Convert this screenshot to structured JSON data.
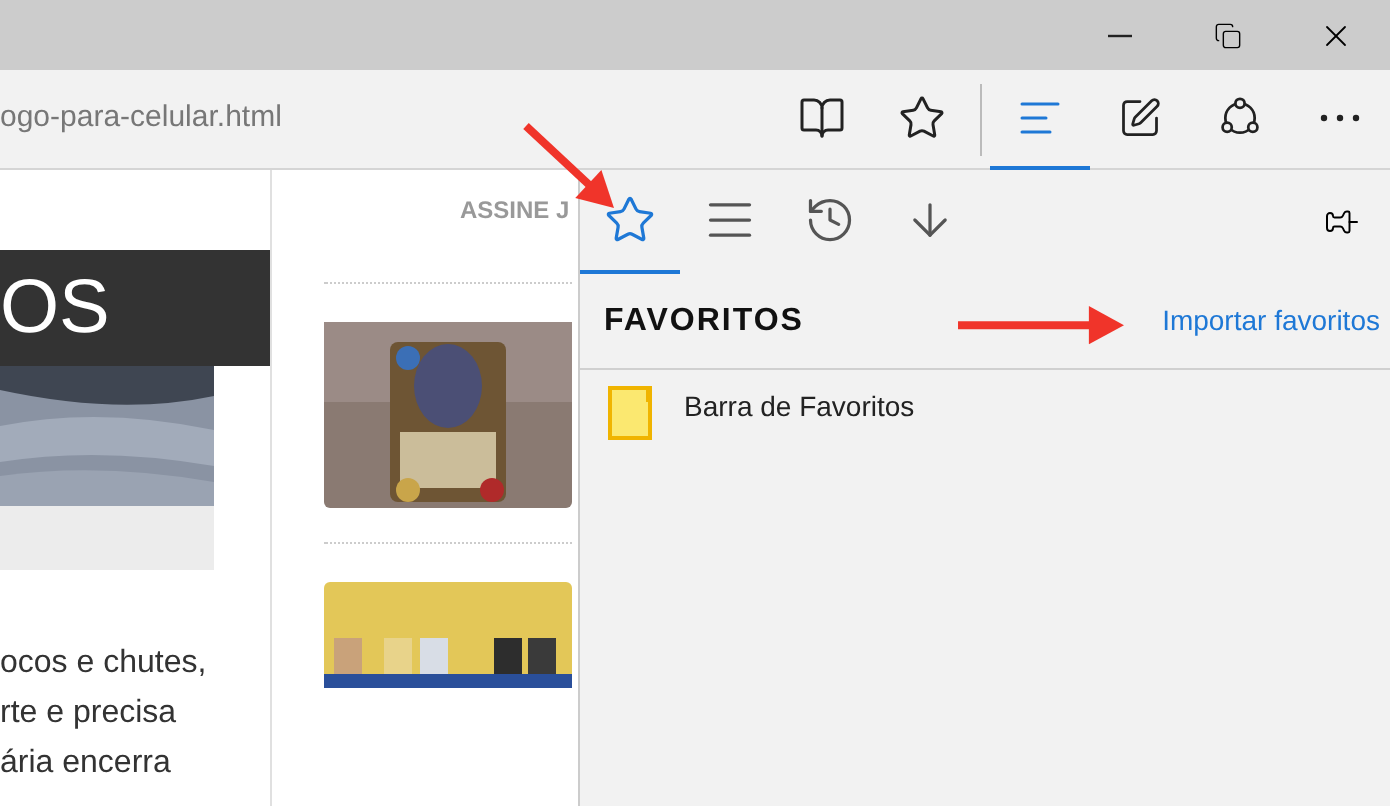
{
  "address_bar": {
    "url": "ogo-para-celular.html"
  },
  "toolbar_buttons": [
    {
      "kind": "reading-view",
      "selected": false
    },
    {
      "kind": "favorite",
      "selected": false
    },
    {
      "kind": "hub",
      "selected": true
    },
    {
      "kind": "note",
      "selected": false
    },
    {
      "kind": "share",
      "selected": false
    },
    {
      "kind": "more",
      "selected": false
    }
  ],
  "page": {
    "subscribe_link": "ASSINE J",
    "heading": "OS",
    "body_lines": [
      "ocos e chutes,",
      "rte e precisa",
      "ária encerra"
    ]
  },
  "hub": {
    "tabs": [
      {
        "kind": "favorites",
        "selected": true
      },
      {
        "kind": "reading-list",
        "selected": false
      },
      {
        "kind": "history",
        "selected": false
      },
      {
        "kind": "downloads",
        "selected": false
      }
    ],
    "title": "FAVORITOS",
    "import_link": "Importar favoritos",
    "items": [
      {
        "label": "Barra de Favoritos"
      }
    ]
  }
}
